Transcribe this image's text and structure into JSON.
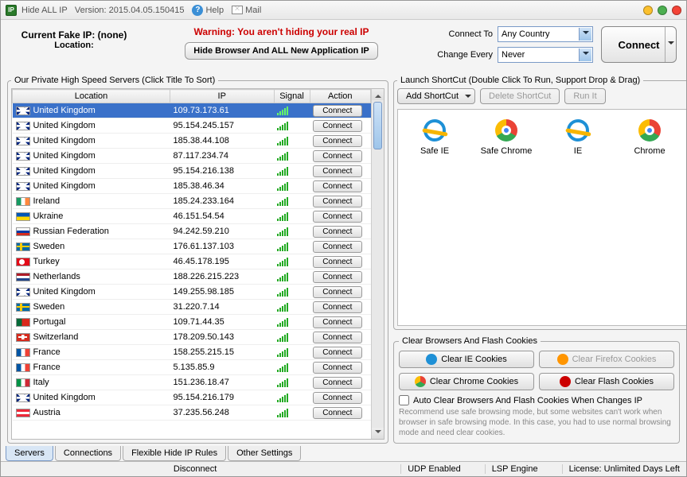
{
  "titlebar": {
    "app_name": "Hide ALL IP",
    "version": "Version: 2015.04.05.150415",
    "help": "Help",
    "mail": "Mail"
  },
  "header": {
    "fake_ip_label": "Current Fake IP: (none)",
    "location_label": "Location:",
    "warning": "Warning: You aren't hiding your real IP",
    "hide_browser_btn": "Hide Browser And ALL New Application IP",
    "connect_to_label": "Connect To",
    "connect_to_value": "Any Country",
    "change_every_label": "Change Every",
    "change_every_value": "Never",
    "connect_btn": "Connect"
  },
  "servers_panel": {
    "title": "Our Private High Speed Servers (Click Title To Sort)",
    "columns": {
      "location": "Location",
      "ip": "IP",
      "signal": "Signal",
      "action": "Action"
    },
    "connect_label": "Connect",
    "rows": [
      {
        "flag": "gb",
        "location": "United Kingdom",
        "ip": "109.73.173.61",
        "selected": true
      },
      {
        "flag": "gb",
        "location": "United Kingdom",
        "ip": "95.154.245.157"
      },
      {
        "flag": "gb",
        "location": "United Kingdom",
        "ip": "185.38.44.108"
      },
      {
        "flag": "gb",
        "location": "United Kingdom",
        "ip": "87.117.234.74"
      },
      {
        "flag": "gb",
        "location": "United Kingdom",
        "ip": "95.154.216.138"
      },
      {
        "flag": "gb",
        "location": "United Kingdom",
        "ip": "185.38.46.34"
      },
      {
        "flag": "ie",
        "location": "Ireland",
        "ip": "185.24.233.164"
      },
      {
        "flag": "ua",
        "location": "Ukraine",
        "ip": "46.151.54.54"
      },
      {
        "flag": "ru",
        "location": "Russian Federation",
        "ip": "94.242.59.210"
      },
      {
        "flag": "se",
        "location": "Sweden",
        "ip": "176.61.137.103"
      },
      {
        "flag": "tr",
        "location": "Turkey",
        "ip": "46.45.178.195"
      },
      {
        "flag": "nl",
        "location": "Netherlands",
        "ip": "188.226.215.223"
      },
      {
        "flag": "gb",
        "location": "United Kingdom",
        "ip": "149.255.98.185"
      },
      {
        "flag": "se",
        "location": "Sweden",
        "ip": "31.220.7.14"
      },
      {
        "flag": "pt",
        "location": "Portugal",
        "ip": "109.71.44.35"
      },
      {
        "flag": "ch",
        "location": "Switzerland",
        "ip": "178.209.50.143"
      },
      {
        "flag": "fr",
        "location": "France",
        "ip": "158.255.215.15"
      },
      {
        "flag": "fr",
        "location": "France",
        "ip": "5.135.85.9"
      },
      {
        "flag": "it",
        "location": "Italy",
        "ip": "151.236.18.47"
      },
      {
        "flag": "gb",
        "location": "United Kingdom",
        "ip": "95.154.216.179"
      },
      {
        "flag": "at",
        "location": "Austria",
        "ip": "37.235.56.248"
      }
    ]
  },
  "launch_panel": {
    "title": "Launch ShortCut (Double Click To Run, Support Drop & Drag)",
    "add_btn": "Add ShortCut",
    "delete_btn": "Delete ShortCut",
    "run_btn": "Run It",
    "items": [
      {
        "icon": "ie",
        "label": "Safe IE"
      },
      {
        "icon": "chrome",
        "label": "Safe Chrome"
      },
      {
        "icon": "ie",
        "label": "IE"
      },
      {
        "icon": "chrome",
        "label": "Chrome"
      }
    ]
  },
  "clear_panel": {
    "title": "Clear Browsers And Flash Cookies",
    "ie": "Clear IE Cookies",
    "firefox": "Clear Firefox Cookies",
    "chrome": "Clear Chrome Cookies",
    "flash": "Clear Flash Cookies",
    "checkbox": "Auto Clear Browsers And Flash Cookies When Changes IP",
    "info": "Recommend use safe browsing mode, but some websites can't work when browser in safe browsing mode. In this case, you had to use normal browsing mode and need clear cookies."
  },
  "tabs": {
    "servers": "Servers",
    "connections": "Connections",
    "flexible": "Flexible Hide IP Rules",
    "other": "Other Settings"
  },
  "statusbar": {
    "disconnect": "Disconnect",
    "udp": "UDP Enabled",
    "lsp": "LSP Engine",
    "license": "License: Unlimited Days Left"
  }
}
